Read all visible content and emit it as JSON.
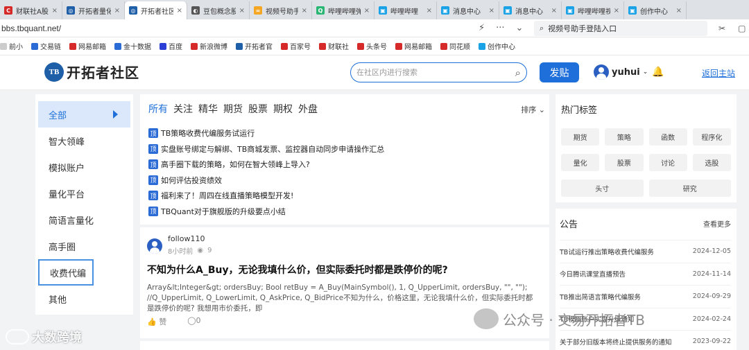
{
  "browser": {
    "tabs": [
      {
        "label": "财联社A股",
        "fav_text": "C",
        "color": "#d62a2a",
        "active": false
      },
      {
        "label": "开拓者量化",
        "fav_text": "◎",
        "color": "#1f5fa8",
        "active": false
      },
      {
        "label": "开拓者社区",
        "fav_text": "◎",
        "color": "#1f5fa8",
        "active": true
      },
      {
        "label": "豆包概念股",
        "fav_text": "◐",
        "color": "#555555",
        "active": false
      },
      {
        "label": "视频号助手",
        "fav_text": "∞",
        "color": "#f5a623",
        "active": false
      },
      {
        "label": "哔哩哔哩弹幕",
        "fav_text": "Q",
        "color": "#2bb673",
        "active": false
      },
      {
        "label": "哔哩哔哩",
        "fav_text": "▣",
        "color": "#1aa2e6",
        "active": false
      },
      {
        "label": "消息中心",
        "fav_text": "▣",
        "color": "#1aa2e6",
        "active": false
      },
      {
        "label": "消息中心",
        "fav_text": "▣",
        "color": "#1aa2e6",
        "active": false
      },
      {
        "label": "哔哩哔哩视",
        "fav_text": "▣",
        "color": "#1aa2e6",
        "active": false
      },
      {
        "label": "创作中心",
        "fav_text": "▣",
        "color": "#1aa2e6",
        "active": false
      }
    ],
    "url": "bbs.tbquant.net/",
    "search_text": "视频号助手登陆入口",
    "bookmarks": [
      {
        "label": "前小",
        "color": "#cccccc"
      },
      {
        "label": "交易链",
        "color": "#2b6bd6"
      },
      {
        "label": "网易邮箱",
        "color": "#d62a2a"
      },
      {
        "label": "金十数据",
        "color": "#2b6bd6"
      },
      {
        "label": "百度",
        "color": "#2b3fd6"
      },
      {
        "label": "新浪微博",
        "color": "#d62a2a"
      },
      {
        "label": "开拓者官",
        "color": "#1f5fa8"
      },
      {
        "label": "百家号",
        "color": "#d62a2a"
      },
      {
        "label": "财联社",
        "color": "#d62a2a"
      },
      {
        "label": "头条号",
        "color": "#d62a2a"
      },
      {
        "label": "网易邮箱",
        "color": "#d62a2a"
      },
      {
        "label": "同花顺",
        "color": "#d62a2a"
      },
      {
        "label": "创作中心",
        "color": "#1aa2e6"
      }
    ]
  },
  "header": {
    "logo_mark": "TB",
    "logo_text": "开拓者社区",
    "search_placeholder": "在社区内进行搜索",
    "post_button": "发贴",
    "username": "yuhui",
    "back_home": "返回主站"
  },
  "sidebar": {
    "items": [
      {
        "label": "全部",
        "active": true
      },
      {
        "label": "智大领峰"
      },
      {
        "label": "模拟账户"
      },
      {
        "label": "量化平台"
      },
      {
        "label": "简语言量化"
      },
      {
        "label": "高手圈"
      },
      {
        "label": "收费代编",
        "boxed": true
      },
      {
        "label": "其他"
      }
    ]
  },
  "feed": {
    "categories": [
      "所有",
      "关注",
      "精华",
      "期货",
      "股票",
      "期权",
      "外盘"
    ],
    "sort_label": "排序",
    "pin_badge": "顶",
    "pinned": [
      "TB策略收费代编服务试运行",
      "实盘账号绑定与解绑、TB商城发票、监控器自动同步申请操作汇总",
      "高手圈下载的策略，如何在智大领峰上导入?",
      "如何评估投资绩效",
      "福利来了！周四在线直播策略模型开发!",
      "TBQuant对于旗舰版的升级要点小结"
    ],
    "post": {
      "user": "follow110",
      "time": "8小时前",
      "views": "9",
      "title": "不知为什么A_Buy，无论我填什么价，但实际委托时都是跌停价的呢?",
      "body": "Array&lt;Integer&gt; ordersBuy; Bool retBuy = A_Buy(MainSymbol(), 1, Q_UpperLimit, ordersBuy, \"\", \"\"); //Q_UpperLimit, Q_LowerLimit, Q_AskPrice, Q_BidPrice不知为什么，价格这里，无论我填什么价，但实际委托时都是跌停价的呢? 我想用市价委托，即",
      "like_label": "赞",
      "comments": "0"
    }
  },
  "hot_tags": {
    "title": "热门标签",
    "tags": [
      "期货",
      "策略",
      "函数",
      "程序化",
      "量化",
      "股票",
      "讨论",
      "选股",
      "头寸",
      "研究"
    ]
  },
  "notice": {
    "title": "公告",
    "more": "查看更多",
    "items": [
      {
        "title": "TB试运行推出策略收费代编服务",
        "date": "2024-12-05"
      },
      {
        "title": "今日腾讯课堂直播预告",
        "date": "2024-11-14"
      },
      {
        "title": "TB推出简语言策略代编服务",
        "date": "2024-09-29"
      },
      {
        "title": "TB模拟账户实盘升级通知",
        "date": "2024-02-24"
      },
      {
        "title": "关于部分旧版本将终止提供服务的通知",
        "date": "2023-09-22"
      }
    ]
  },
  "watermarks": {
    "right": "公众号 · 交易开拓者TB",
    "left": "大数跨境"
  }
}
